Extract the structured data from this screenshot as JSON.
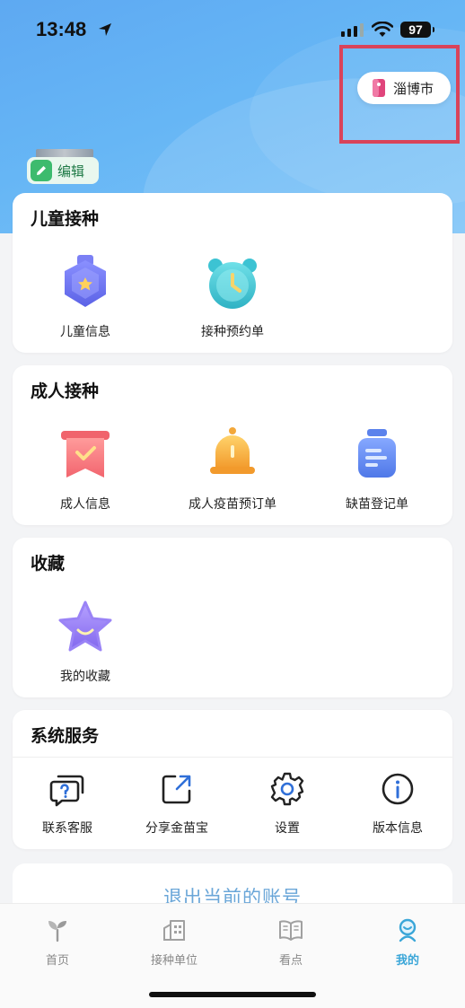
{
  "status_bar": {
    "time": "13:48",
    "battery": "97"
  },
  "header": {
    "city": "淄博市",
    "edit_label": "编辑"
  },
  "sections": {
    "child": {
      "title": "儿童接种",
      "items": [
        {
          "label": "儿童信息",
          "icon": "child-badge-icon"
        },
        {
          "label": "接种预约单",
          "icon": "alarm-clock-icon"
        }
      ]
    },
    "adult": {
      "title": "成人接种",
      "items": [
        {
          "label": "成人信息",
          "icon": "ribbon-check-icon"
        },
        {
          "label": "成人疫苗预订单",
          "icon": "bell-icon"
        },
        {
          "label": "缺苗登记单",
          "icon": "vial-icon"
        }
      ]
    },
    "favorites": {
      "title": "收藏",
      "items": [
        {
          "label": "我的收藏",
          "icon": "star-icon"
        }
      ]
    },
    "services": {
      "title": "系统服务",
      "items": [
        {
          "label": "联系客服",
          "icon": "chat-question-icon"
        },
        {
          "label": "分享金苗宝",
          "icon": "share-icon"
        },
        {
          "label": "设置",
          "icon": "gear-icon"
        },
        {
          "label": "版本信息",
          "icon": "info-icon"
        }
      ]
    }
  },
  "logout_label": "退出当前的账号",
  "tabbar": {
    "items": [
      {
        "label": "首页",
        "icon": "sprout-icon",
        "active": false
      },
      {
        "label": "接种单位",
        "icon": "building-icon",
        "active": false
      },
      {
        "label": "看点",
        "icon": "book-icon",
        "active": false
      },
      {
        "label": "我的",
        "icon": "person-icon",
        "active": true
      }
    ]
  },
  "colors": {
    "accent": "#3aa6d8",
    "highlight_border": "#d9435a",
    "hero_blue": "#5ea9f2"
  }
}
